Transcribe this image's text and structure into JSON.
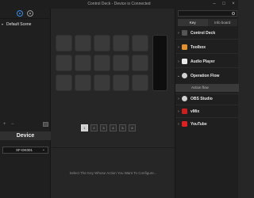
{
  "window": {
    "title": "Control Deck - Device is Connected",
    "controls": [
      "minimize",
      "maximize",
      "close"
    ]
  },
  "left_panel": {
    "icons": [
      "settings-icon",
      "profile-icon"
    ],
    "scene": {
      "expand": "▾",
      "label": "Default Scene"
    },
    "bottom_controls": [
      "+",
      "−"
    ],
    "device_heading": "Device",
    "device_selected": "XF-DK001"
  },
  "center": {
    "pages": [
      "1",
      "2",
      "3",
      "4",
      "5",
      "6"
    ],
    "active_page": "1",
    "hint": "Select The Key Whose Action You Want To Configure..."
  },
  "right_panel": {
    "tabs": [
      "Key",
      "Info board"
    ],
    "active_tab": "Key",
    "categories": [
      {
        "label": "Control Deck",
        "icon": "control-deck-icon",
        "color": "#555555"
      },
      {
        "label": "Toolbox",
        "icon": "toolbox-icon",
        "color": "#e09030"
      },
      {
        "label": "Audio Player",
        "icon": "audio-player-icon",
        "color": "#e8e8e8"
      },
      {
        "label": "Operation Flow",
        "icon": "operation-flow-icon",
        "color": "#d0d0d0"
      },
      {
        "label": "OBS Studio",
        "icon": "obs-studio-icon",
        "color": "#cfcfcf"
      },
      {
        "label": "vMix",
        "icon": "vmix-icon",
        "color": "#c82020"
      },
      {
        "label": "YouTube",
        "icon": "youtube-icon",
        "color": "#e02020"
      }
    ],
    "expanded_sub_item": "Action flow"
  },
  "colors": {
    "accent": "#3b8fe6",
    "background": "#262626",
    "panel": "#1f1f1f"
  }
}
